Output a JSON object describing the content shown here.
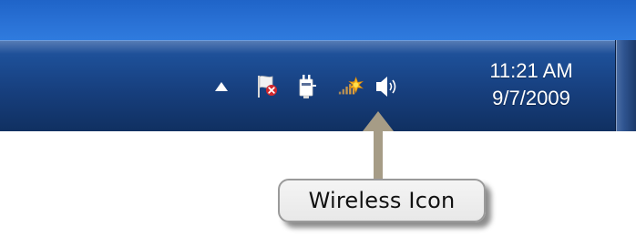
{
  "taskbar": {
    "tray_icons": [
      {
        "name": "show-hidden-icons",
        "icon": "triangle-up-icon"
      },
      {
        "name": "action-center",
        "icon": "flag-with-red-x-icon"
      },
      {
        "name": "power",
        "icon": "power-plug-icon"
      },
      {
        "name": "wireless",
        "icon": "wireless-signal-icon"
      },
      {
        "name": "volume",
        "icon": "speaker-icon"
      }
    ],
    "clock": {
      "time": "11:21 AM",
      "date": "9/7/2009"
    }
  },
  "callout": {
    "label": "Wireless Icon"
  },
  "colors": {
    "taskbar_top": "#27569f",
    "taskbar_bottom": "#103061",
    "desktop_blue": "#2a72d6",
    "arrow": "#a69c86",
    "callout_bg": "#eeeeee",
    "callout_border": "#9a9a9a"
  }
}
